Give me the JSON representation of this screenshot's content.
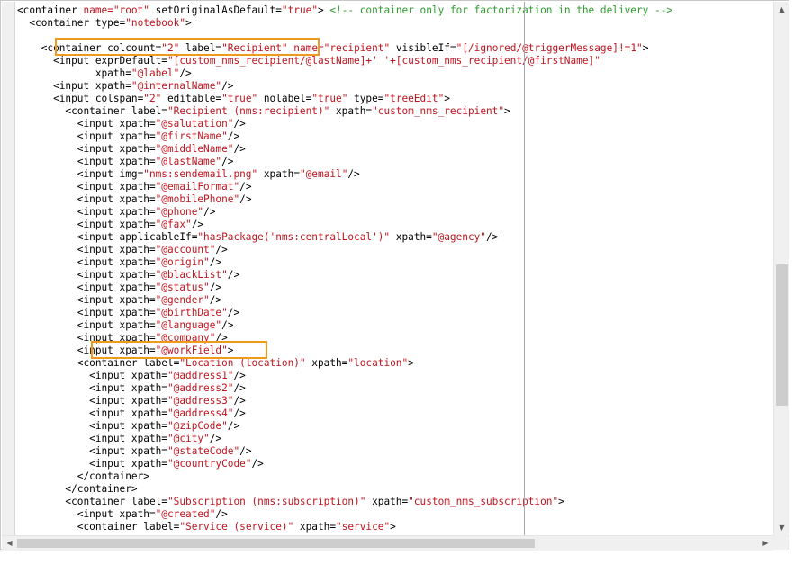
{
  "editor": {
    "lines": [
      [
        [
          "t",
          "<container "
        ],
        [
          "v",
          "name=\"root\""
        ],
        [
          "t",
          " setOriginalAsDefault="
        ],
        [
          "v",
          "\"true\""
        ],
        [
          "t",
          "> "
        ],
        [
          "c",
          "<!-- container only for factorization in the delivery -->"
        ]
      ],
      [
        [
          "t",
          "  <container type="
        ],
        [
          "v",
          "\"notebook\""
        ],
        [
          "t",
          ">"
        ]
      ],
      [],
      [
        [
          "t",
          "    <container colcount="
        ],
        [
          "v",
          "\"2\""
        ],
        [
          "t",
          " label="
        ],
        [
          "v",
          "\"Recipient\""
        ],
        [
          "t",
          " "
        ],
        [
          "v",
          "name=\"recipient\""
        ],
        [
          "t",
          " visibleIf="
        ],
        [
          "v",
          "\"[/ignored/@triggerMessage]!=1\""
        ],
        [
          "t",
          ">"
        ]
      ],
      [
        [
          "t",
          "      <input exprDefault="
        ],
        [
          "v",
          "\"[custom_nms_recipient/@lastName]+' '+[custom_nms_recipient/@firstName]\""
        ]
      ],
      [
        [
          "t",
          "             xpath="
        ],
        [
          "v",
          "\"@label\""
        ],
        [
          "t",
          "/>"
        ]
      ],
      [
        [
          "t",
          "      <input xpath="
        ],
        [
          "v",
          "\"@internalName\""
        ],
        [
          "t",
          "/>"
        ]
      ],
      [
        [
          "t",
          "      <input colspan="
        ],
        [
          "v",
          "\"2\""
        ],
        [
          "t",
          " editable="
        ],
        [
          "v",
          "\"true\""
        ],
        [
          "t",
          " nolabel="
        ],
        [
          "v",
          "\"true\""
        ],
        [
          "t",
          " type="
        ],
        [
          "v",
          "\"treeEdit\""
        ],
        [
          "t",
          ">"
        ]
      ],
      [
        [
          "t",
          "        <container label="
        ],
        [
          "v",
          "\"Recipient (nms:recipient)\""
        ],
        [
          "t",
          " xpath="
        ],
        [
          "v",
          "\"custom_nms_recipient\""
        ],
        [
          "t",
          ">"
        ]
      ],
      [
        [
          "t",
          "          <input xpath="
        ],
        [
          "v",
          "\"@salutation\""
        ],
        [
          "t",
          "/>"
        ]
      ],
      [
        [
          "t",
          "          <input xpath="
        ],
        [
          "v",
          "\"@firstName\""
        ],
        [
          "t",
          "/>"
        ]
      ],
      [
        [
          "t",
          "          <input xpath="
        ],
        [
          "v",
          "\"@middleName\""
        ],
        [
          "t",
          "/>"
        ]
      ],
      [
        [
          "t",
          "          <input xpath="
        ],
        [
          "v",
          "\"@lastName\""
        ],
        [
          "t",
          "/>"
        ]
      ],
      [
        [
          "t",
          "          <input img="
        ],
        [
          "v",
          "\"nms:sendemail.png\""
        ],
        [
          "t",
          " xpath="
        ],
        [
          "v",
          "\"@email\""
        ],
        [
          "t",
          "/>"
        ]
      ],
      [
        [
          "t",
          "          <input xpath="
        ],
        [
          "v",
          "\"@emailFormat\""
        ],
        [
          "t",
          "/>"
        ]
      ],
      [
        [
          "t",
          "          <input xpath="
        ],
        [
          "v",
          "\"@mobilePhone\""
        ],
        [
          "t",
          "/>"
        ]
      ],
      [
        [
          "t",
          "          <input xpath="
        ],
        [
          "v",
          "\"@phone\""
        ],
        [
          "t",
          "/>"
        ]
      ],
      [
        [
          "t",
          "          <input xpath="
        ],
        [
          "v",
          "\"@fax\""
        ],
        [
          "t",
          "/>"
        ]
      ],
      [
        [
          "t",
          "          <input applicableIf="
        ],
        [
          "v",
          "\"hasPackage('nms:centralLocal')\""
        ],
        [
          "t",
          " xpath="
        ],
        [
          "v",
          "\"@agency\""
        ],
        [
          "t",
          "/>"
        ]
      ],
      [
        [
          "t",
          "          <input xpath="
        ],
        [
          "v",
          "\"@account\""
        ],
        [
          "t",
          "/>"
        ]
      ],
      [
        [
          "t",
          "          <input xpath="
        ],
        [
          "v",
          "\"@origin\""
        ],
        [
          "t",
          "/>"
        ]
      ],
      [
        [
          "t",
          "          <input xpath="
        ],
        [
          "v",
          "\"@blackList\""
        ],
        [
          "t",
          "/>"
        ]
      ],
      [
        [
          "t",
          "          <input xpath="
        ],
        [
          "v",
          "\"@status\""
        ],
        [
          "t",
          "/>"
        ]
      ],
      [
        [
          "t",
          "          <input xpath="
        ],
        [
          "v",
          "\"@gender\""
        ],
        [
          "t",
          "/>"
        ]
      ],
      [
        [
          "t",
          "          <input xpath="
        ],
        [
          "v",
          "\"@birthDate\""
        ],
        [
          "t",
          "/>"
        ]
      ],
      [
        [
          "t",
          "          <input xpath="
        ],
        [
          "v",
          "\"@language\""
        ],
        [
          "t",
          "/>"
        ]
      ],
      [
        [
          "t",
          "          <input xpath="
        ],
        [
          "v",
          "\"@company\""
        ],
        [
          "t",
          "/>"
        ]
      ],
      [
        [
          "t",
          "          <input xpath="
        ],
        [
          "v",
          "\"@workField\""
        ],
        [
          "t",
          ">"
        ]
      ],
      [
        [
          "t",
          "          <container label="
        ],
        [
          "v",
          "\"Location (location)\""
        ],
        [
          "t",
          " xpath="
        ],
        [
          "v",
          "\"location\""
        ],
        [
          "t",
          ">"
        ]
      ],
      [
        [
          "t",
          "            <input xpath="
        ],
        [
          "v",
          "\"@address1\""
        ],
        [
          "t",
          "/>"
        ]
      ],
      [
        [
          "t",
          "            <input xpath="
        ],
        [
          "v",
          "\"@address2\""
        ],
        [
          "t",
          "/>"
        ]
      ],
      [
        [
          "t",
          "            <input xpath="
        ],
        [
          "v",
          "\"@address3\""
        ],
        [
          "t",
          "/>"
        ]
      ],
      [
        [
          "t",
          "            <input xpath="
        ],
        [
          "v",
          "\"@address4\""
        ],
        [
          "t",
          "/>"
        ]
      ],
      [
        [
          "t",
          "            <input xpath="
        ],
        [
          "v",
          "\"@zipCode\""
        ],
        [
          "t",
          "/>"
        ]
      ],
      [
        [
          "t",
          "            <input xpath="
        ],
        [
          "v",
          "\"@city\""
        ],
        [
          "t",
          "/>"
        ]
      ],
      [
        [
          "t",
          "            <input xpath="
        ],
        [
          "v",
          "\"@stateCode\""
        ],
        [
          "t",
          "/>"
        ]
      ],
      [
        [
          "t",
          "            <input xpath="
        ],
        [
          "v",
          "\"@countryCode\""
        ],
        [
          "t",
          "/>"
        ]
      ],
      [
        [
          "t",
          "          </container>"
        ]
      ],
      [
        [
          "t",
          "        </container>"
        ]
      ],
      [
        [
          "t",
          "        <container label="
        ],
        [
          "v",
          "\"Subscription (nms:subscription)\""
        ],
        [
          "t",
          " xpath="
        ],
        [
          "v",
          "\"custom_nms_subscription\""
        ],
        [
          "t",
          ">"
        ]
      ],
      [
        [
          "t",
          "          <input xpath="
        ],
        [
          "v",
          "\"@created\""
        ],
        [
          "t",
          "/>"
        ]
      ],
      [
        [
          "t",
          "          <container label="
        ],
        [
          "v",
          "\"Service (service)\""
        ],
        [
          "t",
          " xpath="
        ],
        [
          "v",
          "\"service\""
        ],
        [
          "t",
          ">"
        ]
      ]
    ],
    "highlights": [
      {
        "line": 3,
        "label": "highlight-container-recipient"
      },
      {
        "line": 27,
        "label": "highlight-input-workfield"
      }
    ]
  },
  "colors": {
    "tag": "#000000",
    "value": "#c0141e",
    "comment": "#2c9b2c",
    "highlight": "#f09a1c"
  },
  "scrollbars": {
    "up_arrow": "▲",
    "down_arrow": "▼",
    "left_arrow": "◀",
    "right_arrow": "▶"
  }
}
